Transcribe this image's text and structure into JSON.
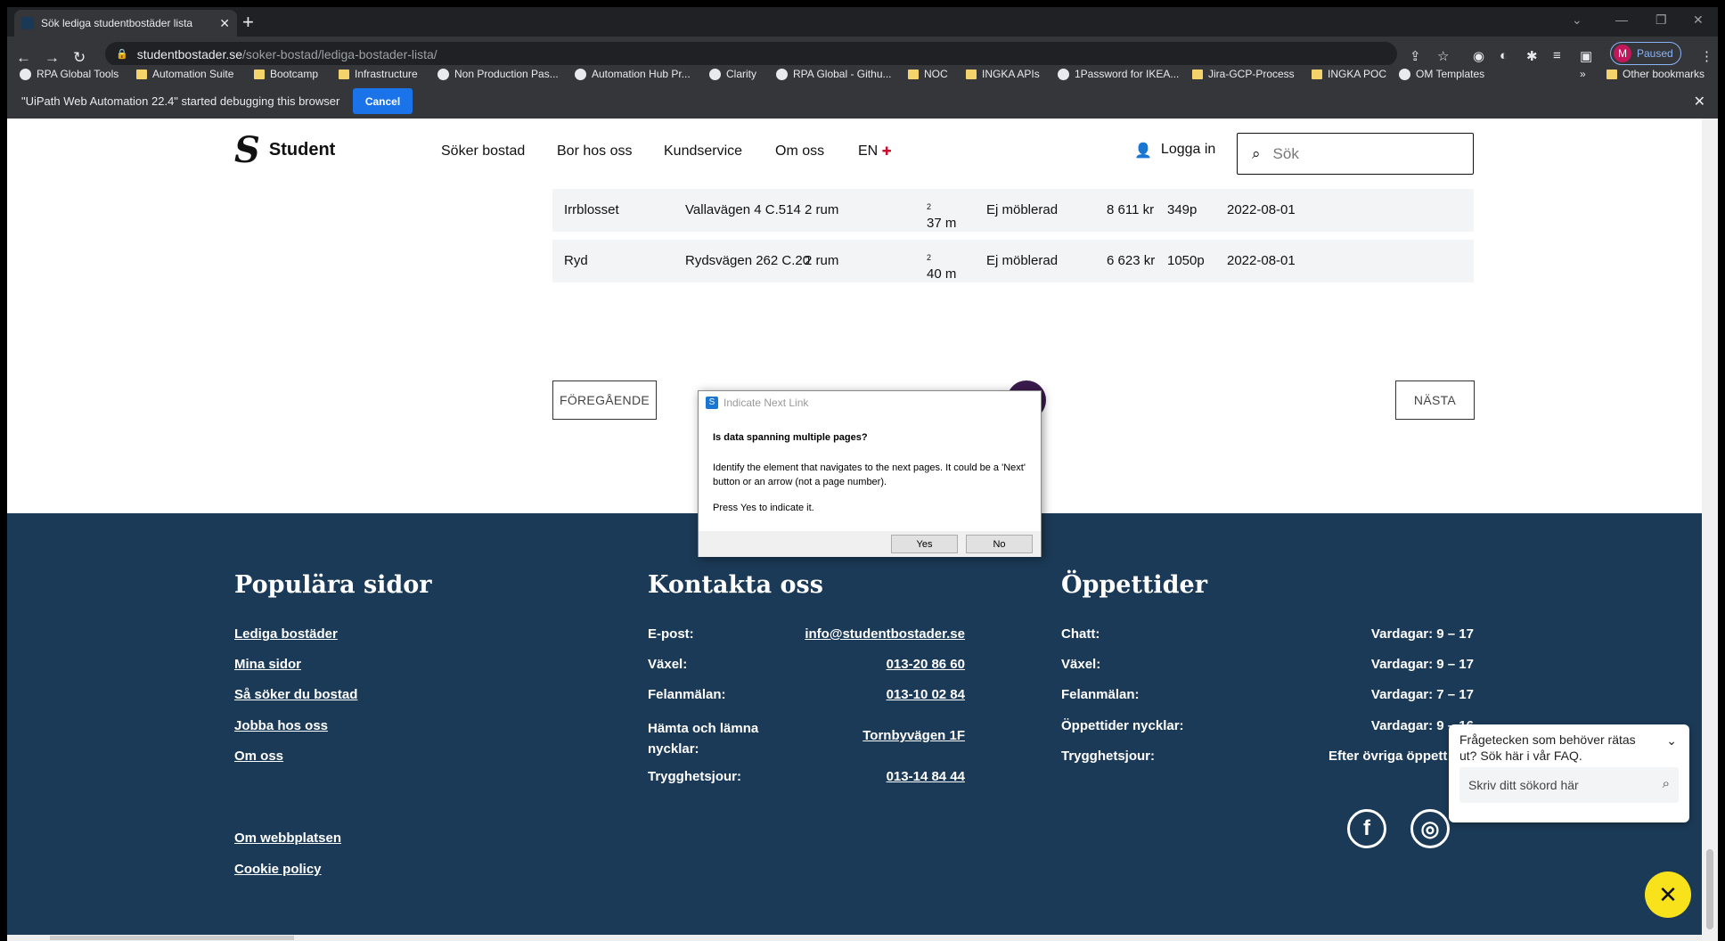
{
  "browser": {
    "tab_title": "Sök lediga studentbostäder lista",
    "url_host": "studentbostader.se",
    "url_path": "/soker-bostad/lediga-bostader-lista/",
    "profile_label": "Paused",
    "profile_initial": "M"
  },
  "bookmarks": [
    "RPA Global Tools",
    "Automation Suite",
    "Bootcamp",
    "Infrastructure",
    "Non Production Pas...",
    "Automation Hub Pr...",
    "Clarity",
    "RPA Global - Githu...",
    "NOC",
    "INGKA APIs",
    "1Password for IKEA...",
    "Jira-GCP-Process",
    "INGKA POC",
    "OM Templates"
  ],
  "other_bookmarks": "Other bookmarks",
  "debug": {
    "message": "\"UiPath Web Automation 22.4\" started debugging this browser",
    "cancel": "Cancel"
  },
  "site": {
    "logo_text": "Student",
    "nav": [
      "Söker bostad",
      "Bor hos oss",
      "Kundservice",
      "Om oss",
      "EN"
    ],
    "login": "Logga in",
    "search_placeholder": "Sök"
  },
  "listings": [
    {
      "area": "Irrblosset",
      "address": "Vallavägen 4 C.514",
      "rooms": "2 rum",
      "size": "37 m",
      "furnished": "Ej möblerad",
      "rent": "8 611 kr",
      "points": "349p",
      "date": "2022-08-01"
    },
    {
      "area": "Ryd",
      "address": "Rydsvägen 262 C.20",
      "rooms": "2 rum",
      "size": "40 m",
      "furnished": "Ej möblerad",
      "rent": "6 623 kr",
      "points": "1050p",
      "date": "2022-08-01"
    }
  ],
  "pagination": {
    "prev": "FÖREGÅENDE",
    "next": "NÄSTA"
  },
  "footer": {
    "popular_title": "Populära sidor",
    "popular_links": [
      "Lediga bostäder",
      "Mina sidor",
      "Så söker du bostad",
      "Jobba hos oss",
      "Om oss"
    ],
    "bottom_links": [
      "Om webbplatsen",
      "Cookie policy"
    ],
    "contact_title": "Kontakta oss",
    "contact": [
      {
        "label": "E-post:",
        "value": "info@studentbostader.se"
      },
      {
        "label": "Växel:",
        "value": "013-20 86 60"
      },
      {
        "label": "Felanmälan:",
        "value": "013-10 02 84"
      },
      {
        "label": "Hämta och lämna nycklar:",
        "value": "Tornbyvägen 1F"
      },
      {
        "label": "Trygghetsjour:",
        "value": "013-14 84 44"
      }
    ],
    "hours_title": "Öppettider",
    "hours": [
      {
        "label": "Chatt:",
        "value": "Vardagar: 9 – 17"
      },
      {
        "label": "Växel:",
        "value": "Vardagar: 9 – 17"
      },
      {
        "label": "Felanmälan:",
        "value": "Vardagar: 7 – 17"
      },
      {
        "label": "Öppettider nycklar:",
        "value": "Vardagar: 9 – 16"
      },
      {
        "label": "Trygghetsjour:",
        "value": "Efter övriga öppett"
      }
    ]
  },
  "faq": {
    "question": "Frågetecken som behöver rätas ut? Sök här i vår FAQ.",
    "placeholder": "Skriv ditt sökord här"
  },
  "dialog": {
    "title": "Indicate Next Link",
    "heading": "Is data spanning multiple pages?",
    "text": "Identify the element that navigates to the next pages. It could be a 'Next' button or an arrow (not a page number).",
    "text2": "Press Yes to indicate it.",
    "yes": "Yes",
    "no": "No"
  }
}
